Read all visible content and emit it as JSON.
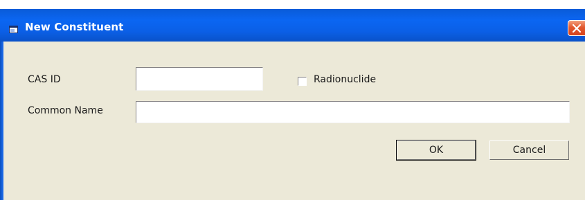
{
  "window": {
    "title": "New Constituent"
  },
  "form": {
    "cas_id": {
      "label": "CAS ID",
      "value": ""
    },
    "radionuclide": {
      "label": "Radionuclide",
      "checked": false
    },
    "common_name": {
      "label": "Common Name",
      "value": ""
    }
  },
  "buttons": {
    "ok_label": "OK",
    "cancel_label": "Cancel"
  },
  "colors": {
    "titlebar": "#0b62ea",
    "client_bg": "#ece9d8",
    "close_button": "#e2592f"
  },
  "icons": {
    "title_icon": "window-app-icon",
    "close": "close-x-icon"
  }
}
